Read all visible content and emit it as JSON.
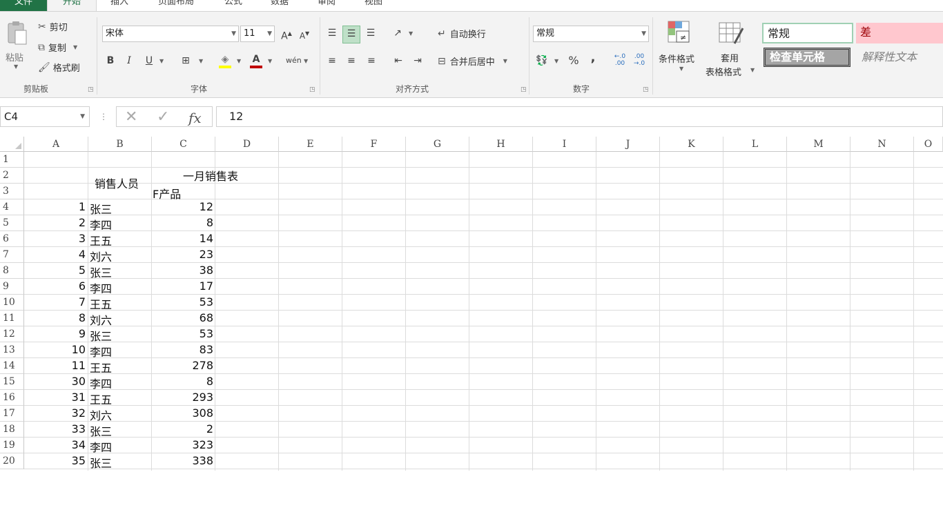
{
  "tabs": [
    "文件",
    "开始",
    "插入",
    "页面布局",
    "公式",
    "数据",
    "审阅",
    "视图"
  ],
  "clipboard": {
    "paste": "粘贴",
    "cut": "剪切",
    "copy": "复制",
    "format_painter": "格式刷",
    "title": "剪贴板"
  },
  "font": {
    "name": "宋体",
    "size": "11",
    "grow": "A",
    "shrink": "A",
    "bold": "B",
    "italic": "I",
    "underline": "U",
    "color_letter": "A",
    "wen": "wén",
    "title": "字体"
  },
  "alignment": {
    "wrap": "自动换行",
    "merge": "合并后居中",
    "title": "对齐方式"
  },
  "number": {
    "format": "常规",
    "percent": "%",
    "comma": ",",
    "inc_dec": "←.0 .00",
    "dec_dec": ".00 →.0",
    "title": "数字"
  },
  "styles": {
    "conditional": "条件格式",
    "table_format_1": "套用",
    "table_format_2": "表格格式",
    "normal": "常规",
    "bad": "差",
    "check_cell": "检查单元格",
    "explanatory": "解释性文本"
  },
  "formula_bar": {
    "name_box": "C4",
    "fx": "fx",
    "value": "12"
  },
  "columns": [
    "A",
    "B",
    "C",
    "D",
    "E",
    "F",
    "G",
    "H",
    "I",
    "J",
    "K",
    "L",
    "M",
    "N",
    "O"
  ],
  "rows": [
    "1",
    "2",
    "3",
    "4",
    "5",
    "6",
    "7",
    "8",
    "9",
    "10",
    "11",
    "12",
    "13",
    "14",
    "15",
    "16",
    "17",
    "18",
    "19",
    "20"
  ],
  "sheet": {
    "header_salesperson": "销售人员",
    "title_jan": "一月销售表",
    "product_f": "F产品",
    "data": [
      {
        "a": "1",
        "b": "张三",
        "c": "12"
      },
      {
        "a": "2",
        "b": "李四",
        "c": "8"
      },
      {
        "a": "3",
        "b": "王五",
        "c": "14"
      },
      {
        "a": "4",
        "b": "刘六",
        "c": "23"
      },
      {
        "a": "5",
        "b": "张三",
        "c": "38"
      },
      {
        "a": "6",
        "b": "李四",
        "c": "17"
      },
      {
        "a": "7",
        "b": "王五",
        "c": "53"
      },
      {
        "a": "8",
        "b": "刘六",
        "c": "68"
      },
      {
        "a": "9",
        "b": "张三",
        "c": "53"
      },
      {
        "a": "10",
        "b": "李四",
        "c": "83"
      },
      {
        "a": "11",
        "b": "王五",
        "c": "278"
      },
      {
        "a": "30",
        "b": "李四",
        "c": "8"
      },
      {
        "a": "31",
        "b": "王五",
        "c": "293"
      },
      {
        "a": "32",
        "b": "刘六",
        "c": "308"
      },
      {
        "a": "33",
        "b": "张三",
        "c": "2"
      },
      {
        "a": "34",
        "b": "李四",
        "c": "323"
      },
      {
        "a": "35",
        "b": "张三",
        "c": "338"
      }
    ]
  },
  "colors": {
    "excel_green": "#217346",
    "bad_fill": "#ffc7ce",
    "bad_text": "#9c0006",
    "check_fill": "#a5a5a5",
    "font_color_bar": "#c00000",
    "highlight_bar": "#ffff00"
  }
}
